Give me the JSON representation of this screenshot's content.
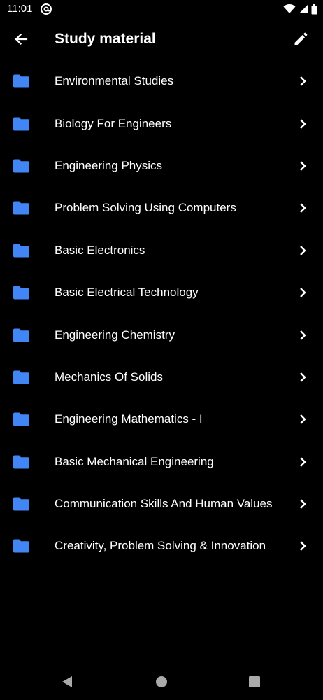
{
  "status_bar": {
    "time": "11:01",
    "icons": [
      "at-sign-icon",
      "wifi-icon",
      "signal-icon",
      "battery-icon"
    ]
  },
  "app_bar": {
    "title": "Study material",
    "back_icon": "arrow-back-icon",
    "edit_icon": "pencil-icon"
  },
  "colors": {
    "background": "#000000",
    "text": "#ffffff",
    "folder_accent": "#4285f4",
    "nav_icons": "#aaaaaa"
  },
  "folders": [
    {
      "label": "Environmental Studies"
    },
    {
      "label": "Biology For Engineers"
    },
    {
      "label": "Engineering Physics"
    },
    {
      "label": "Problem Solving Using Computers"
    },
    {
      "label": "Basic Electronics"
    },
    {
      "label": "Basic Electrical Technology"
    },
    {
      "label": "Engineering Chemistry"
    },
    {
      "label": "Mechanics Of Solids"
    },
    {
      "label": "Engineering Mathematics - I"
    },
    {
      "label": "Basic Mechanical Engineering"
    },
    {
      "label": "Communication Skills And Human Values"
    },
    {
      "label": "Creativity, Problem Solving & Innovation"
    }
  ],
  "nav_bar": {
    "icons": [
      "nav-back-icon",
      "nav-home-icon",
      "nav-recents-icon"
    ]
  }
}
